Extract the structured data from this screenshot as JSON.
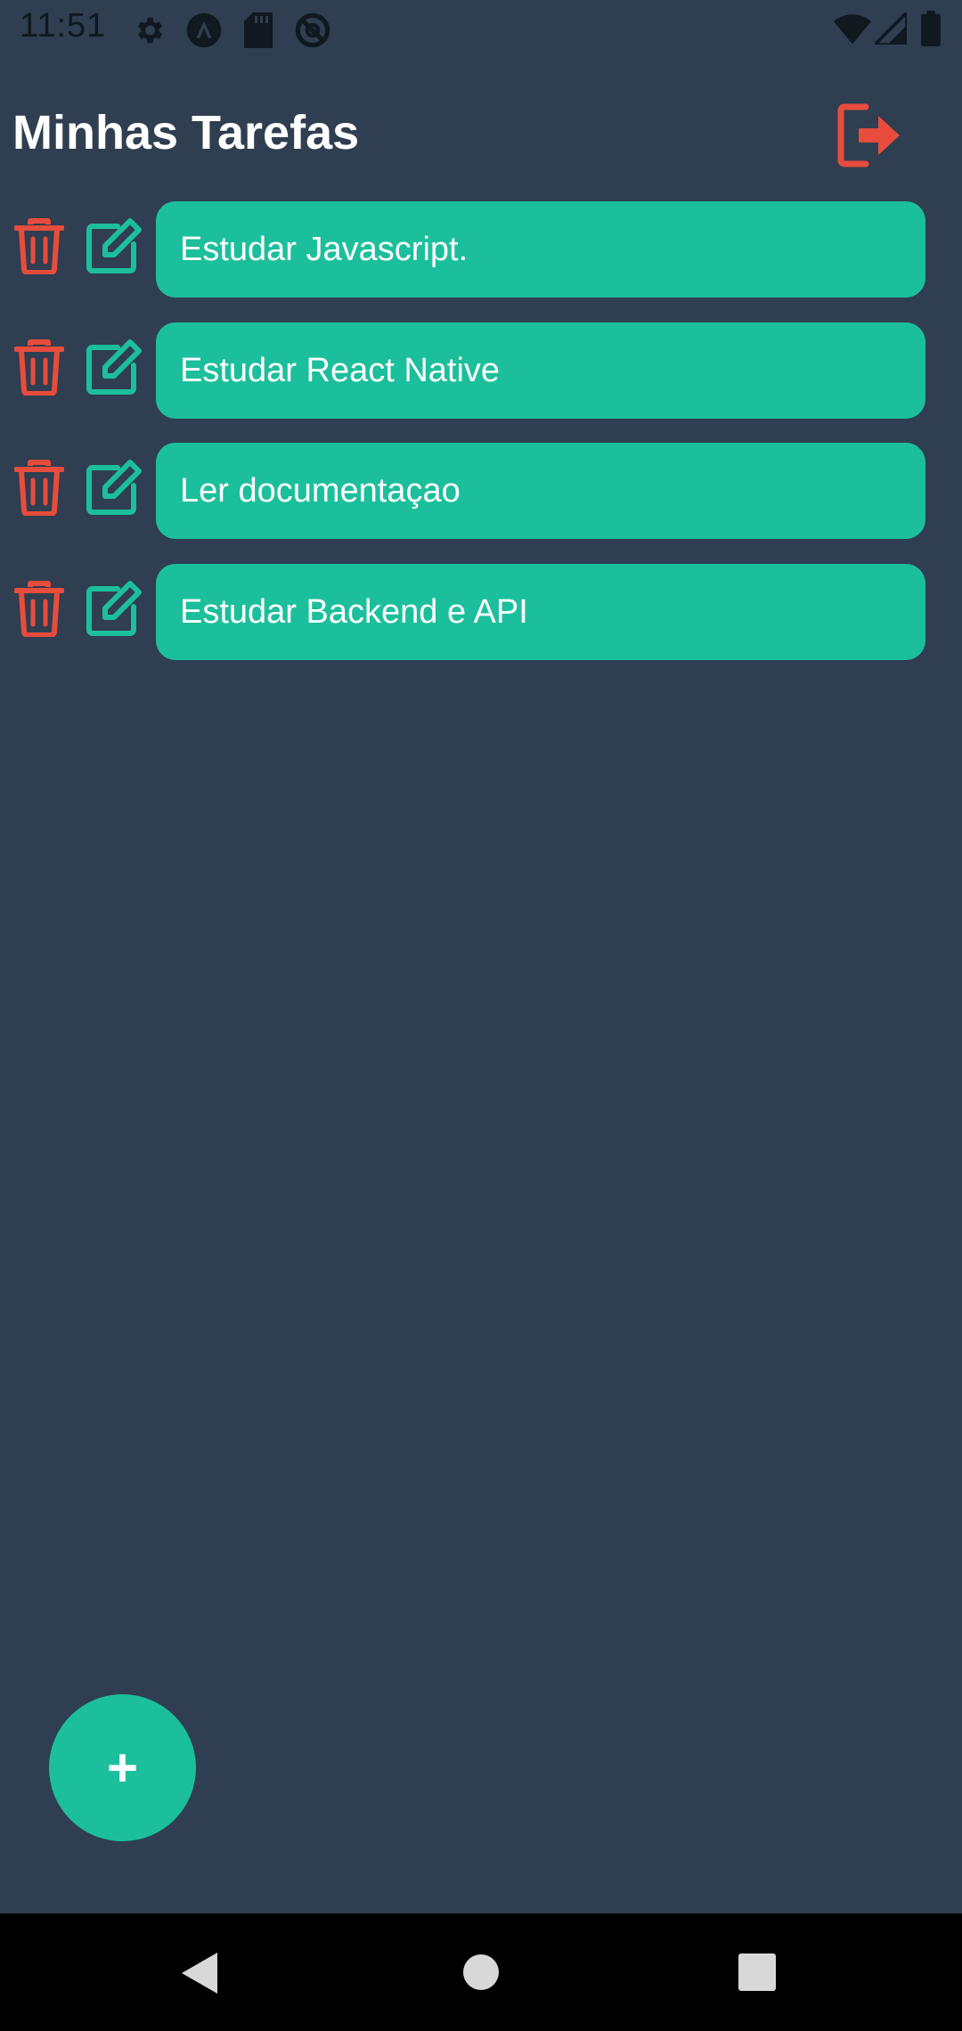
{
  "status_bar": {
    "time": "11:51",
    "icons": [
      "gear-icon",
      "launcher-icon",
      "sd-card-icon",
      "no-disturb-icon",
      "wifi-icon",
      "signal-icon",
      "battery-icon"
    ]
  },
  "header": {
    "title": "Minhas Tarefas",
    "logout_icon": "logout-icon"
  },
  "tasks": [
    {
      "text": "Estudar Javascript."
    },
    {
      "text": "Estudar React Native"
    },
    {
      "text": "Ler documentaçao"
    },
    {
      "text": "Estudar Backend e API"
    }
  ],
  "fab": {
    "label": "+"
  },
  "nav_bar": {
    "buttons": [
      "back-icon",
      "home-icon",
      "recents-icon"
    ]
  },
  "colors": {
    "background": "#2f3e50",
    "accent": "#1cbf9c",
    "danger": "#e74c3c",
    "text": "#ffffff"
  }
}
